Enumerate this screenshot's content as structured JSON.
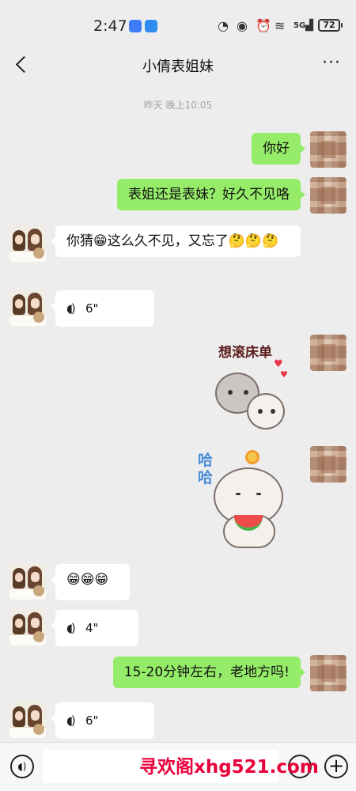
{
  "status_bar": {
    "time": "2:47",
    "network": "5G",
    "battery": "72"
  },
  "header": {
    "title": "小倩表姐妹",
    "back_icon": "chevron-left-icon",
    "more_icon": "more-dots-icon"
  },
  "timestamp": "昨天 晚上10:05",
  "messages": [
    {
      "from": "me",
      "type": "text",
      "text": "你好"
    },
    {
      "from": "me",
      "type": "text",
      "text": "表姐还是表妹？好久不见咯"
    },
    {
      "from": "her",
      "type": "text",
      "text": "你猜😁这么久不见，又忘了🤔🤔🤔"
    },
    {
      "from": "her",
      "type": "voice",
      "duration": "6\""
    },
    {
      "from": "me",
      "type": "sticker",
      "caption": "想滚床单"
    },
    {
      "from": "me",
      "type": "sticker",
      "caption": "哈哈"
    },
    {
      "from": "her",
      "type": "text",
      "text": "😁😁😁"
    },
    {
      "from": "her",
      "type": "voice",
      "duration": "4\""
    },
    {
      "from": "me",
      "type": "text",
      "text": "15-20分钟左右，老地方吗!"
    },
    {
      "from": "her",
      "type": "voice",
      "duration": "6\""
    }
  ],
  "watermark": "寻欢阁xhg521.com",
  "colors": {
    "background": "#ededed",
    "sent_bubble": "#95ec69",
    "received_bubble": "#ffffff",
    "watermark": "#e8003b"
  }
}
